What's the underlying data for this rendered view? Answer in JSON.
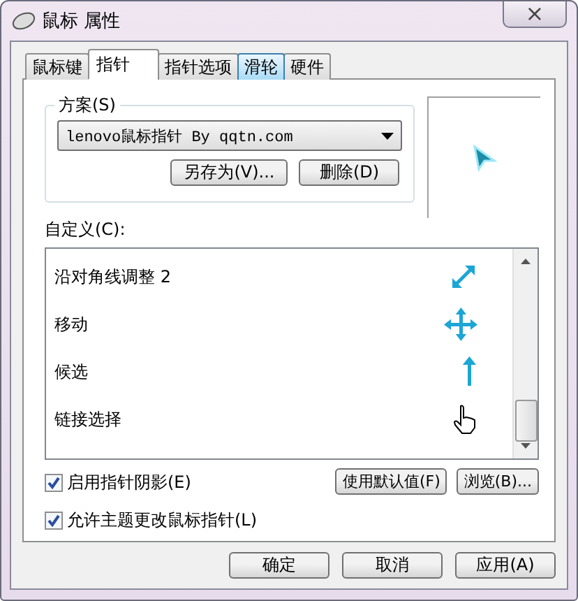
{
  "window": {
    "title": "鼠标 属性",
    "close": "×"
  },
  "tabs": [
    {
      "label": "鼠标键",
      "selected": false,
      "highlighted": false
    },
    {
      "label": "指针",
      "selected": true,
      "highlighted": false
    },
    {
      "label": "指针选项",
      "selected": false,
      "highlighted": false
    },
    {
      "label": "滑轮",
      "selected": false,
      "highlighted": true
    },
    {
      "label": "硬件",
      "selected": false,
      "highlighted": false
    }
  ],
  "scheme": {
    "label": "方案(S)",
    "value": "lenovo鼠标指针 By qqtn.com",
    "buttons": [
      "另存为(V)...",
      "删除(D)"
    ]
  },
  "customize": {
    "label": "自定义(C):",
    "items": [
      {
        "name": "沿对角线调整 2",
        "kind": "diagonal"
      },
      {
        "name": "移动",
        "kind": "move"
      },
      {
        "name": "候选",
        "kind": "alternate"
      },
      {
        "name": "链接选择",
        "kind": "link"
      }
    ]
  },
  "options": [
    {
      "label": "启用指针阴影(E)",
      "checked": true
    },
    {
      "label": "允许主题更改鼠标指针(L)",
      "checked": true
    }
  ],
  "option_buttons": [
    "使用默认值(F)",
    "浏览(B)..."
  ],
  "footer_buttons": [
    "确定",
    "取消",
    "应用(A)"
  ]
}
